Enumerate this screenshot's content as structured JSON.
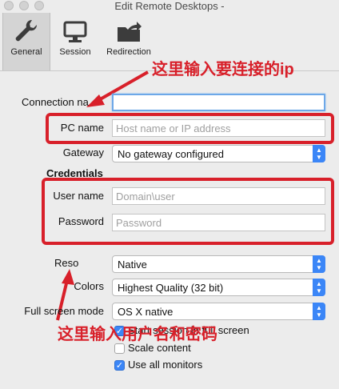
{
  "window": {
    "title": "Edit Remote Desktops -"
  },
  "toolbar": {
    "tabs": [
      {
        "label": "General",
        "icon": "wrench-icon",
        "active": true
      },
      {
        "label": "Session",
        "icon": "monitor-icon",
        "active": false
      },
      {
        "label": "Redirection",
        "icon": "folder-export-icon",
        "active": false
      }
    ]
  },
  "form": {
    "connection_name_label": "Connection na",
    "connection_name_value": "",
    "pc_name_label": "PC name",
    "pc_name_placeholder": "Host name or IP address",
    "gateway_label": "Gateway",
    "gateway_value": "No gateway configured",
    "credentials_heading": "Credentials",
    "user_name_label": "User name",
    "user_name_placeholder": "Domain\\user",
    "password_label": "Password",
    "password_placeholder": "Password",
    "resolution_label": "Reso",
    "resolution_value": "Native",
    "colors_label": "Colors",
    "colors_value": "Highest Quality (32 bit)",
    "full_screen_mode_label": "Full screen mode",
    "full_screen_mode_value": "OS X native",
    "checkboxes": [
      {
        "label": "Start session in full screen",
        "checked": true
      },
      {
        "label": "Scale content",
        "checked": false
      },
      {
        "label": "Use all monitors",
        "checked": true
      }
    ]
  },
  "annotations": {
    "top_note": "这里输入要连接的ip",
    "bottom_note": "这里输入用户名和密码"
  },
  "colors": {
    "accent": "#3b86f7",
    "annotation": "#d8202a"
  }
}
